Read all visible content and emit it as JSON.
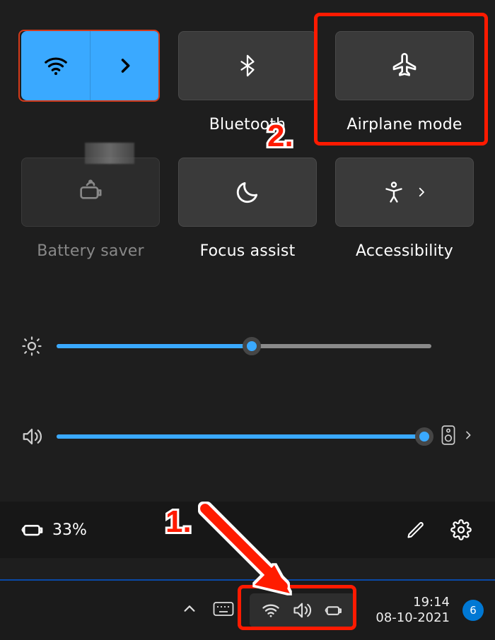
{
  "tiles": {
    "wifi": {
      "label": "",
      "active": true
    },
    "bluetooth": {
      "label": "Bluetooth"
    },
    "airplane": {
      "label": "Airplane mode"
    },
    "battery": {
      "label": "Battery saver"
    },
    "focus": {
      "label": "Focus assist"
    },
    "access": {
      "label": "Accessibility"
    }
  },
  "sliders": {
    "brightness": {
      "percent": 52
    },
    "volume": {
      "percent": 100
    }
  },
  "footer": {
    "battery_text": "33%"
  },
  "taskbar": {
    "time": "19:14",
    "date": "08-10-2021",
    "notif_count": "6"
  },
  "annotations": {
    "one": "1.",
    "two": "2."
  }
}
